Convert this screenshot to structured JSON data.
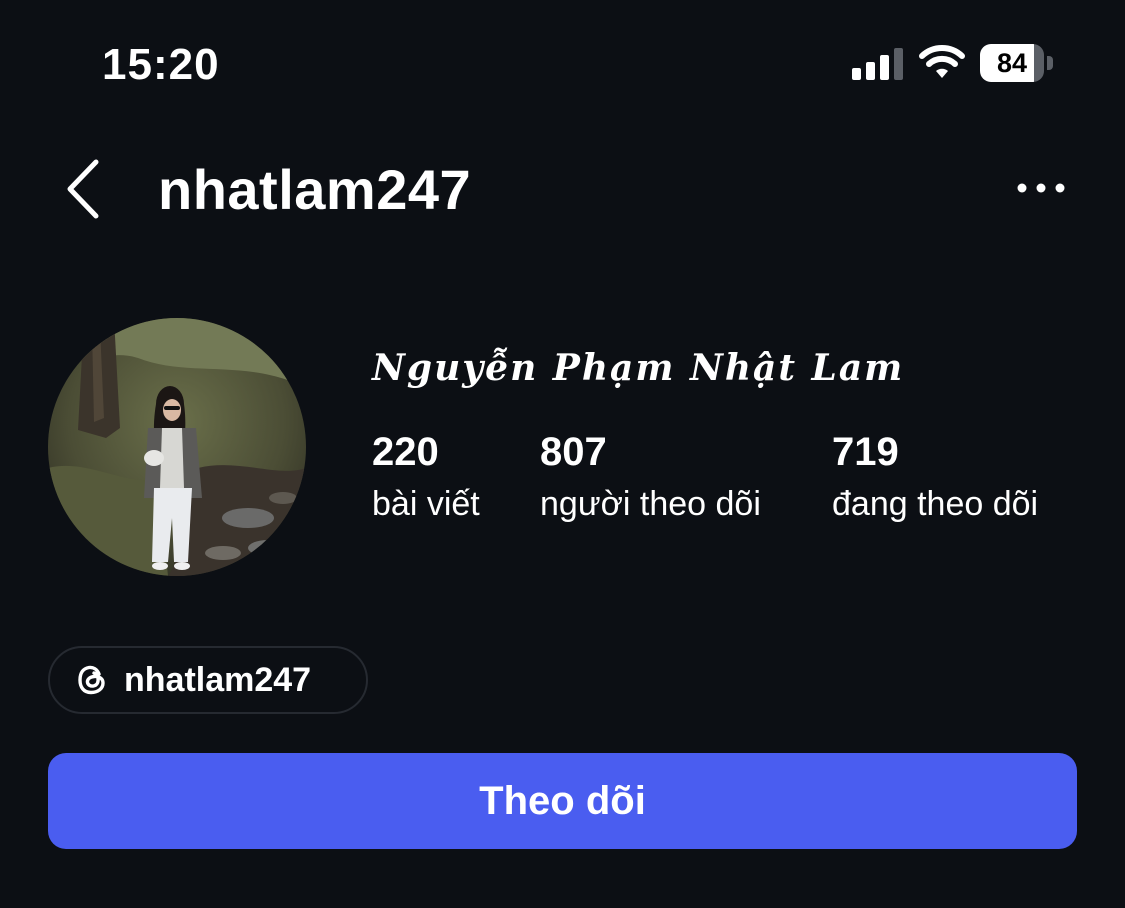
{
  "status_bar": {
    "time": "15:20",
    "battery_level": "84",
    "signal_icon": "cellular-signal-icon",
    "wifi_icon": "wifi-icon",
    "battery_icon": "battery-icon"
  },
  "header": {
    "username": "nhatlam247",
    "back_icon": "chevron-left-icon",
    "more_icon": "more-horizontal-icon"
  },
  "profile": {
    "full_name": "Nguyễn Phạm Nhật Lam",
    "avatar_icon": "profile-photo"
  },
  "stats": [
    {
      "value": "220",
      "label": "bài viết"
    },
    {
      "value": "807",
      "label": "người theo dõi"
    },
    {
      "value": "719",
      "label": "đang theo dõi"
    }
  ],
  "threads_chip": {
    "label": "nhatlam247",
    "icon": "threads-icon"
  },
  "actions": {
    "follow_label": "Theo dõi"
  },
  "colors": {
    "background": "#0c0f14",
    "text": "#ffffff",
    "follow_button": "#4a5df0",
    "chip_border": "#262a31"
  }
}
